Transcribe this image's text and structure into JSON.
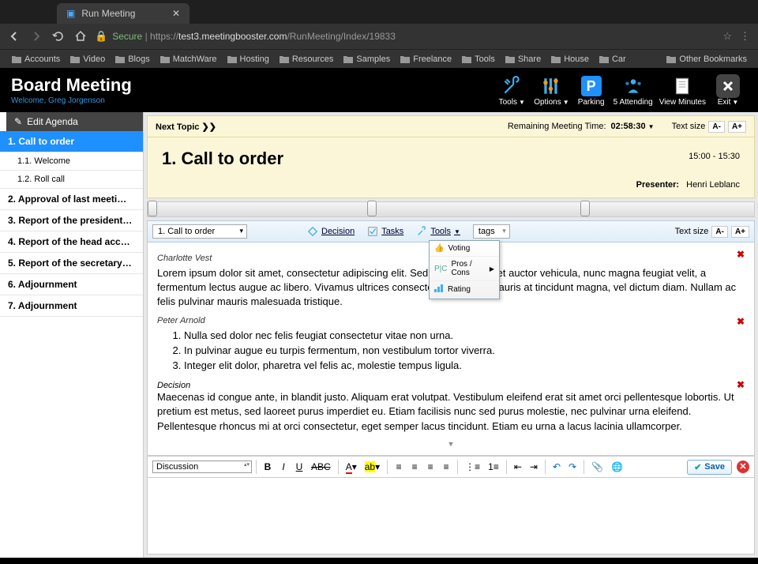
{
  "browser": {
    "tab_title": "Run Meeting",
    "url_secure": "Secure",
    "url_prefix": "https://",
    "url_host": "test3.meetingbooster.com",
    "url_path": "/RunMeeting/Index/19833",
    "bookmarks": [
      "Accounts",
      "Video",
      "Blogs",
      "MatchWare",
      "Hosting",
      "Resources",
      "Samples",
      "Freelance",
      "Tools",
      "Share",
      "House",
      "Car"
    ],
    "other_bookmarks": "Other Bookmarks"
  },
  "header": {
    "title": "Board Meeting",
    "welcome": "Welcome, Greg Jorgenson",
    "tools": "Tools",
    "options": "Options",
    "parking": "Parking",
    "attending": "5 Attending",
    "view_minutes": "View Minutes",
    "exit": "Exit"
  },
  "sidebar": {
    "edit_agenda": "Edit Agenda",
    "items": [
      {
        "label": "1. Call to order",
        "active": true
      },
      {
        "label": "1.1. Welcome",
        "sub": true
      },
      {
        "label": "1.2. Roll call",
        "sub": true
      },
      {
        "label": "2. Approval of last meeti…"
      },
      {
        "label": "3. Report of the president…"
      },
      {
        "label": "4. Report of the head acc…"
      },
      {
        "label": "5. Report of the secretary…"
      },
      {
        "label": "6. Adjournment"
      },
      {
        "label": "7. Adjournment"
      }
    ]
  },
  "topbar": {
    "next_topic": "Next Topic",
    "remaining_label": "Remaining Meeting Time:",
    "remaining_value": "02:58:30",
    "textsize_label": "Text size"
  },
  "topic": {
    "title": "1. Call to order",
    "time_range": "15:00 - 15:30",
    "presenter_label": "Presenter:",
    "presenter_name": "Henri Leblanc"
  },
  "toolbar": {
    "current_topic": "1. Call to order",
    "decision": "Decision",
    "tasks": "Tasks",
    "tools": "Tools",
    "tags": "tags",
    "textsize_label": "Text size",
    "menu": {
      "voting": "Voting",
      "proscons": "Pros / Cons",
      "rating": "Rating"
    }
  },
  "notes": {
    "author1": "Charlotte Vest",
    "text1": "Lorem ipsum dolor sit amet, consectetur adipiscing elit. Sed sed orci sit amet auctor vehicula, nunc magna feugiat velit, a fermentum lectus augue ac libero. Vivamus ultrices consectetur orci non. Mauris at tincidunt magna, vel dictum diam. Nullam ac felis pulvinar mauris malesuada tristique.",
    "author2": "Peter Arnold",
    "item2a": "Nulla sed dolor nec felis feugiat consectetur vitae non urna.",
    "item2b": "In pulvinar augue eu turpis fermentum, non vestibulum tortor viverra.",
    "item2c": "Integer elit dolor, pharetra vel felis ac, molestie tempus ligula.",
    "decision_label": "Decision",
    "decision_text": "Maecenas id congue ante, in blandit justo. Aliquam erat volutpat. Vestibulum eleifend erat sit amet orci pellentesque lobortis. Ut pretium est metus, sed laoreet purus imperdiet eu. Etiam facilisis nunc sed purus molestie, nec pulvinar urna eleifend. Pellentesque rhoncus mi at orci consectetur, eget semper lacus tincidunt. Etiam eu urna a lacus lacinia ullamcorper."
  },
  "editor": {
    "type_select": "Discussion",
    "save": "Save"
  }
}
